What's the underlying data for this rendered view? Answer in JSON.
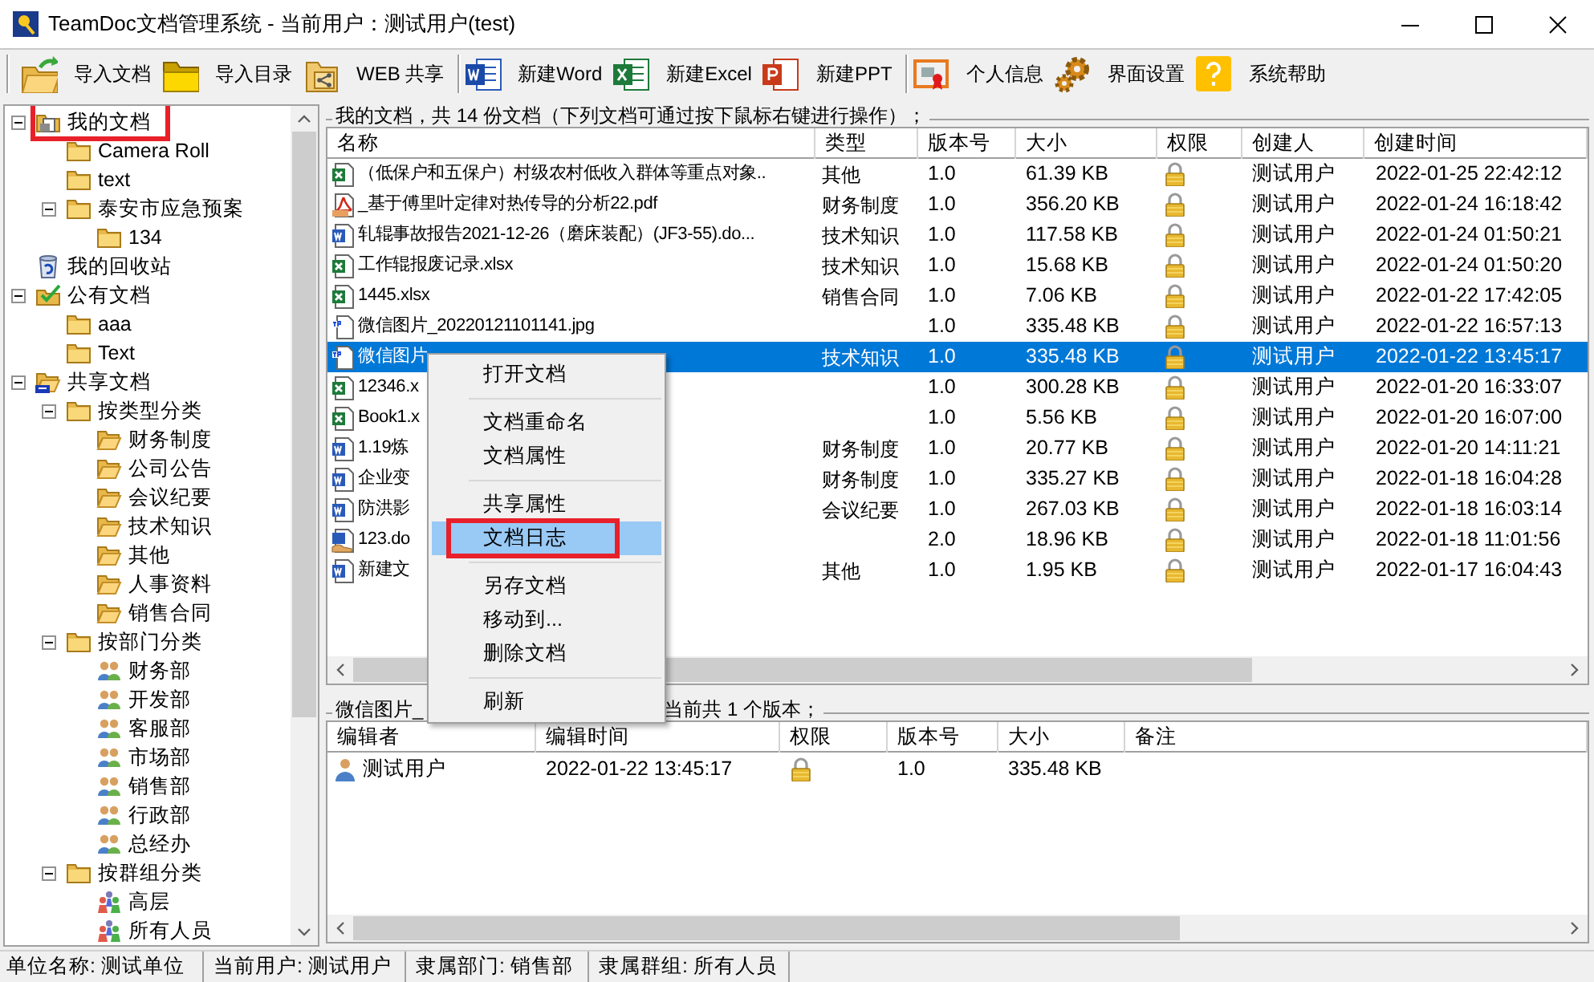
{
  "window": {
    "title": "TeamDoc文档管理系统 - 当前用户：测试用户(test)"
  },
  "toolbar": [
    {
      "label": "导入文档"
    },
    {
      "label": "导入目录"
    },
    {
      "label": "WEB 共享",
      "separator_after": true
    },
    {
      "label": "新建Word"
    },
    {
      "label": "新建Excel"
    },
    {
      "label": "新建PPT",
      "separator_after": true
    },
    {
      "label": "个人信息"
    },
    {
      "label": "界面设置"
    },
    {
      "label": "系统帮助"
    }
  ],
  "tree": [
    {
      "label": "我的文档",
      "kind": "mydocs",
      "expanded": true,
      "annotated": true,
      "children": [
        {
          "label": "Camera Roll",
          "kind": "folder"
        },
        {
          "label": "text",
          "kind": "folder"
        },
        {
          "label": "泰安市应急预案",
          "kind": "folder",
          "expanded": true,
          "children": [
            {
              "label": "134",
              "kind": "folder"
            }
          ]
        }
      ]
    },
    {
      "label": "我的回收站",
      "kind": "recycle"
    },
    {
      "label": "公有文档",
      "kind": "public",
      "expanded": true,
      "children": [
        {
          "label": "aaa",
          "kind": "folder"
        },
        {
          "label": "Text",
          "kind": "folder"
        }
      ]
    },
    {
      "label": "共享文档",
      "kind": "shared",
      "expanded": true,
      "children": [
        {
          "label": "按类型分类",
          "kind": "folder",
          "expanded": true,
          "children": [
            {
              "label": "财务制度",
              "kind": "open-folder"
            },
            {
              "label": "公司公告",
              "kind": "open-folder"
            },
            {
              "label": "会议纪要",
              "kind": "open-folder"
            },
            {
              "label": "技术知识",
              "kind": "open-folder"
            },
            {
              "label": "其他",
              "kind": "open-folder"
            },
            {
              "label": "人事资料",
              "kind": "open-folder"
            },
            {
              "label": "销售合同",
              "kind": "open-folder"
            }
          ]
        },
        {
          "label": "按部门分类",
          "kind": "folder",
          "expanded": true,
          "children": [
            {
              "label": "财务部",
              "kind": "dept"
            },
            {
              "label": "开发部",
              "kind": "dept"
            },
            {
              "label": "客服部",
              "kind": "dept"
            },
            {
              "label": "市场部",
              "kind": "dept"
            },
            {
              "label": "销售部",
              "kind": "dept"
            },
            {
              "label": "行政部",
              "kind": "dept"
            },
            {
              "label": "总经办",
              "kind": "dept"
            }
          ]
        },
        {
          "label": "按群组分类",
          "kind": "folder",
          "expanded": true,
          "children": [
            {
              "label": "高层",
              "kind": "team"
            },
            {
              "label": "所有人员",
              "kind": "team"
            }
          ]
        }
      ]
    }
  ],
  "documents": {
    "title": "我的文档，共 14 份文档（下列文档可通过按下鼠标右键进行操作）；",
    "columns": [
      "名称",
      "类型",
      "版本号",
      "大小",
      "权限",
      "创建人",
      "创建时间"
    ],
    "rows": [
      {
        "kind": "excel",
        "name": "（低保户和五保户）村级农村低收入群体等重点对象..",
        "type": "其他",
        "version": "1.0",
        "size": "61.39 KB",
        "creator": "测试用户",
        "created": "2022-01-25 22:42:12",
        "selected": false
      },
      {
        "kind": "pdf",
        "name": "_基于傅里叶定律对热传导的分析22.pdf",
        "type": "财务制度",
        "version": "1.0",
        "size": "356.20 KB",
        "creator": "测试用户",
        "created": "2022-01-24 16:18:42",
        "selected": false
      },
      {
        "kind": "word",
        "name": "轧辊事故报告2021-12-26（磨床装配）(JF3-55).do...",
        "type": "技术知识",
        "version": "1.0",
        "size": "117.58 KB",
        "creator": "测试用户",
        "created": "2022-01-24 01:50:21",
        "selected": false
      },
      {
        "kind": "excel",
        "name": "工作辊报废记录.xlsx",
        "type": "技术知识",
        "version": "1.0",
        "size": "15.68 KB",
        "creator": "测试用户",
        "created": "2022-01-24 01:50:20",
        "selected": false
      },
      {
        "kind": "excel",
        "name": "1445.xlsx",
        "type": "销售合同",
        "version": "1.0",
        "size": "7.06 KB",
        "creator": "测试用户",
        "created": "2022-01-22 17:42:05",
        "selected": false
      },
      {
        "kind": "jpg",
        "name": "微信图片_20220121101141.jpg",
        "version": "1.0",
        "size": "335.48 KB",
        "creator": "测试用户",
        "created": "2022-01-22 16:57:13",
        "selected": false
      },
      {
        "kind": "jpg",
        "name": "微信图片",
        "type": "技术知识",
        "version": "1.0",
        "size": "335.48 KB",
        "creator": "测试用户",
        "created": "2022-01-22 13:45:17",
        "selected": true
      },
      {
        "kind": "excel",
        "name": "12346.x",
        "version": "1.0",
        "size": "300.28 KB",
        "creator": "测试用户",
        "created": "2022-01-20 16:33:07",
        "selected": false
      },
      {
        "kind": "excel",
        "name": "Book1.x",
        "version": "1.0",
        "size": "5.56 KB",
        "creator": "测试用户",
        "created": "2022-01-20 16:07:00",
        "selected": false
      },
      {
        "kind": "word",
        "name": "1.19炼",
        "type": "财务制度",
        "version": "1.0",
        "size": "20.77 KB",
        "creator": "测试用户",
        "created": "2022-01-20 14:11:21",
        "selected": false
      },
      {
        "kind": "word",
        "name": "企业变",
        "type": "财务制度",
        "version": "1.0",
        "size": "335.27 KB",
        "creator": "测试用户",
        "created": "2022-01-18 16:04:28",
        "selected": false
      },
      {
        "kind": "word",
        "name": "防洪影",
        "type": "会议纪要",
        "version": "1.0",
        "size": "267.03 KB",
        "creator": "测试用户",
        "created": "2022-01-18 16:03:14",
        "selected": false
      },
      {
        "kind": "shared-word",
        "name": "123.do",
        "version": "2.0",
        "size": "18.96 KB",
        "creator": "测试用户",
        "created": "2022-01-18 11:01:56",
        "selected": false
      },
      {
        "kind": "word",
        "name": "新建文",
        "type": "其他",
        "version": "1.0",
        "size": "1.95 KB",
        "creator": "测试用户",
        "created": "2022-01-17 16:04:43",
        "selected": false
      }
    ]
  },
  "versions": {
    "title_start": "微信图片_",
    "title_end": "当前共 1 个版本；",
    "columns": [
      "编辑者",
      "编辑时间",
      "权限",
      "版本号",
      "大小",
      "备注"
    ],
    "rows": [
      {
        "editor": "测试用户",
        "time": "2022-01-22 13:45:17",
        "version": "1.0",
        "size": "335.48 KB"
      }
    ]
  },
  "context_menu": [
    {
      "label": "打开文档",
      "selected": false
    },
    {
      "kind": "separator"
    },
    {
      "label": "文档重命名",
      "selected": false
    },
    {
      "label": "文档属性",
      "selected": false
    },
    {
      "kind": "separator"
    },
    {
      "label": "共享属性",
      "selected": false
    },
    {
      "label": "文档日志",
      "selected": true,
      "annotated": true
    },
    {
      "kind": "separator"
    },
    {
      "label": "另存文档",
      "selected": false
    },
    {
      "label": "移动到...",
      "selected": false
    },
    {
      "label": "删除文档",
      "selected": false
    },
    {
      "kind": "separator"
    },
    {
      "label": "刷新",
      "selected": false
    }
  ],
  "status_bar": [
    "单位名称: 测试单位",
    "当前用户: 测试用户",
    "隶属部门: 销售部",
    "隶属群组: 所有人员"
  ]
}
